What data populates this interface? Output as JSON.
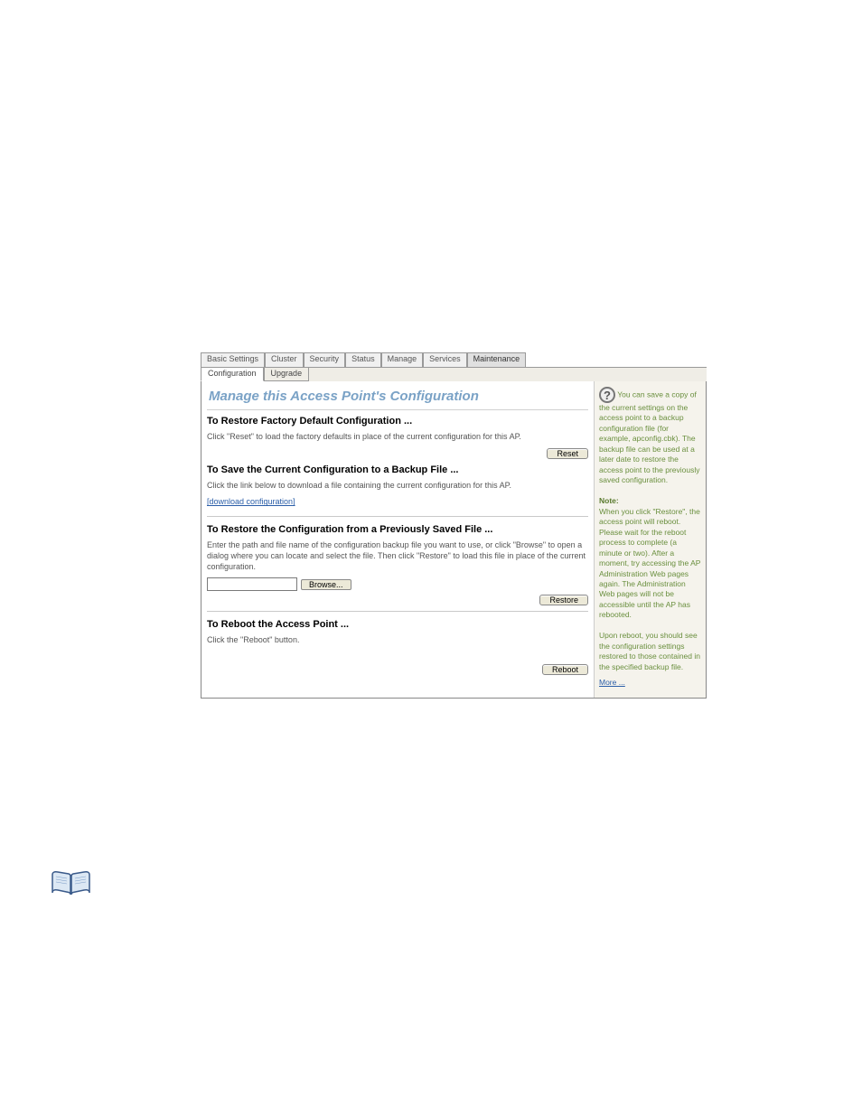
{
  "tabs": [
    {
      "label": "Basic Settings"
    },
    {
      "label": "Cluster"
    },
    {
      "label": "Security"
    },
    {
      "label": "Status"
    },
    {
      "label": "Manage"
    },
    {
      "label": "Services"
    },
    {
      "label": "Maintenance"
    }
  ],
  "subtabs": [
    {
      "label": "Configuration"
    },
    {
      "label": "Upgrade"
    }
  ],
  "title": "Manage this Access Point's Configuration",
  "sections": {
    "factory": {
      "heading": "To Restore Factory Default Configuration ...",
      "text": "Click \"Reset\" to load the factory defaults in place of the current configuration for this AP.",
      "button": "Reset"
    },
    "save": {
      "heading": "To Save the Current Configuration to a Backup File ...",
      "text": "Click the link below to download a file containing the current configuration for this AP.",
      "link": "[download configuration]"
    },
    "restore": {
      "heading": "To Restore the Configuration from a Previously Saved File ...",
      "text": "Enter the path and file name of the configuration backup file you want to use, or click \"Browse\" to open a dialog where you can locate and select the file.  Then click \"Restore\" to load this file in place of the current configuration.",
      "browse": "Browse...",
      "button": "Restore"
    },
    "reboot": {
      "heading": "To Reboot the Access Point ...",
      "text": "Click the \"Reboot\" button.",
      "button": "Reboot"
    }
  },
  "sidebar": {
    "intro": "You can save a copy of the current settings on the access point to a backup configuration file (for example, apconfig.cbk). The backup file can be used at a later date to restore the access point to the previously saved configuration.",
    "note_label": "Note:",
    "note1": "When you click \"Restore\", the access point will reboot. Please wait for the reboot process to complete (a minute or two). After a moment, try accessing the AP Administration Web pages again. The Administration Web pages will not be accessible until the AP has rebooted.",
    "note2": "Upon reboot, you should see the configuration settings restored to those contained in the specified backup file.",
    "more": "More ..."
  }
}
